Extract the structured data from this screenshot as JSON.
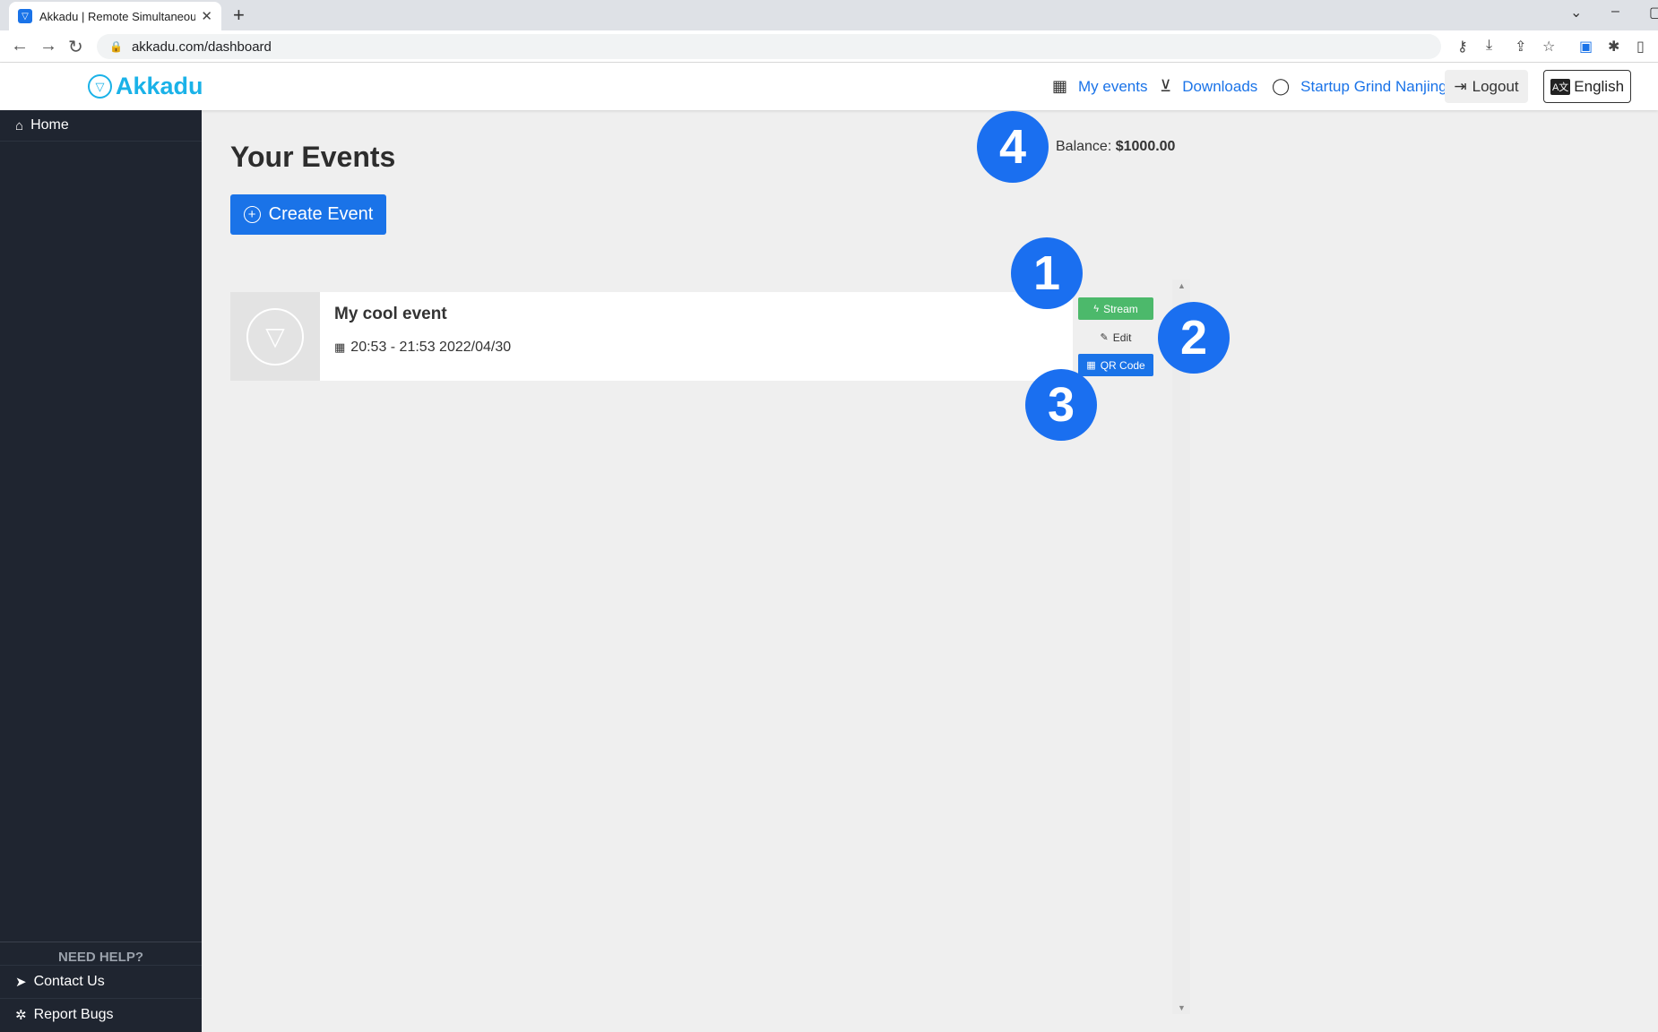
{
  "browser": {
    "tab_title": "Akkadu | Remote Simultaneou",
    "new_tab": "+",
    "url": "akkadu.com/dashboard"
  },
  "header": {
    "logo_text": "Akkadu",
    "nav": {
      "my_events": "My events",
      "downloads": "Downloads",
      "user": "Startup Grind Nanjing"
    },
    "logout": "Logout",
    "language": "English"
  },
  "sidebar": {
    "home": "Home",
    "need_help": "NEED HELP?",
    "contact": "Contact Us",
    "report": "Report Bugs"
  },
  "main": {
    "title": "Your Events",
    "create_button": "Create Event",
    "balance_label": "Balance:",
    "balance_value": "$1000.00",
    "events": [
      {
        "title": "My cool event",
        "time": "20:53 - 21:53 2022/04/30",
        "actions": {
          "stream": "Stream",
          "edit": "Edit",
          "qr": "QR Code"
        }
      }
    ]
  },
  "markers": [
    "1",
    "2",
    "3",
    "4"
  ],
  "colors": {
    "brand": "#1ab2e8",
    "primary": "#1a73e8",
    "stream": "#4cb96b",
    "sidebar": "#1f2530",
    "marker": "#1a6ff0"
  }
}
